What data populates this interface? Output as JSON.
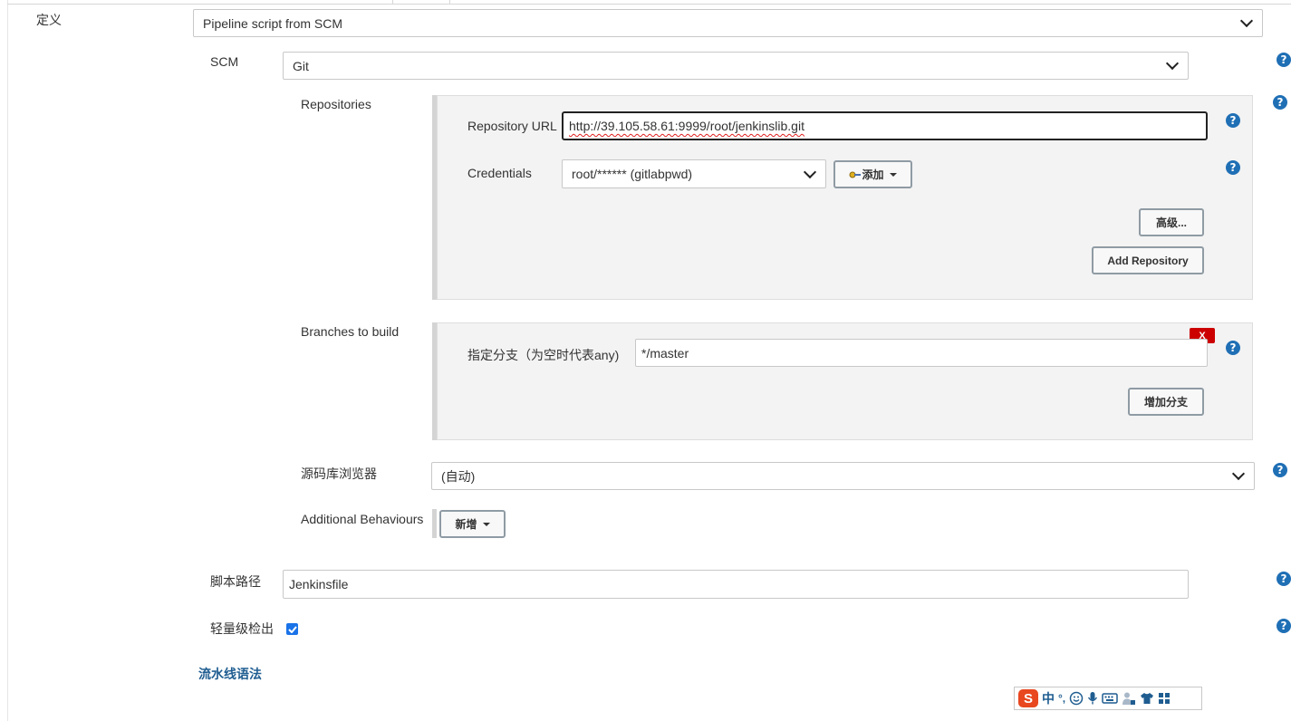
{
  "definition": {
    "label": "定义",
    "value": "Pipeline script from SCM"
  },
  "scm": {
    "label": "SCM",
    "value": "Git"
  },
  "repositories": {
    "label": "Repositories",
    "url_label": "Repository URL",
    "url_value": "http://39.105.58.61:9999/root/jenkinslib.git",
    "credentials_label": "Credentials",
    "credentials_value": "root/****** (gitlabpwd)",
    "add_label": "添加",
    "advanced_label": "高级...",
    "add_repository_label": "Add Repository"
  },
  "branches": {
    "label": "Branches to build",
    "delete_label": "X",
    "branch_label": "指定分支（为空时代表any)",
    "branch_value": "*/master",
    "add_branch_label": "增加分支"
  },
  "browser": {
    "label": "源码库浏览器",
    "value": "(自动)"
  },
  "behaviours": {
    "label": "Additional Behaviours",
    "add_label": "新增"
  },
  "script_path": {
    "label": "脚本路径",
    "value": "Jenkinsfile"
  },
  "lightweight": {
    "label": "轻量级检出",
    "checked": true
  },
  "pipeline_syntax": {
    "label": "流水线语法"
  },
  "help_icon": "?",
  "ime": {
    "logo": "S",
    "lang": "中",
    "punct": "°,"
  },
  "colors": {
    "help": "#1f6fb5",
    "delete": "#cc0000",
    "checkbox": "#1a73e8",
    "link": "#1f5d91"
  }
}
